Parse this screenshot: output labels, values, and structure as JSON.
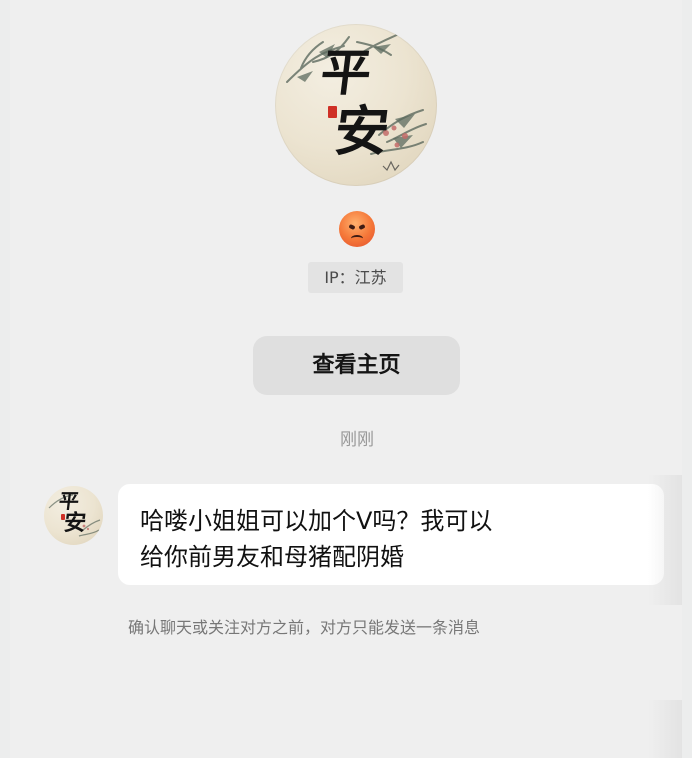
{
  "profile": {
    "avatar_text": {
      "line1": "平",
      "line2": "安"
    },
    "status_icon": "angry-face-icon",
    "ip_label": "IP：江苏",
    "homepage_button_label": "查看主页"
  },
  "chat": {
    "timestamp": "刚刚",
    "sender_avatar_text": {
      "line1": "平",
      "line2": "安"
    },
    "message": "哈喽小姐姐可以加个V吗？我可以\n给你前男友和母猪配阴婚",
    "notice": "确认聊天或关注对方之前，对方只能发送一条消息"
  },
  "colors": {
    "background": "#efefef",
    "bubble": "#ffffff",
    "button": "#dfdfdf",
    "notice_text": "#777777"
  }
}
